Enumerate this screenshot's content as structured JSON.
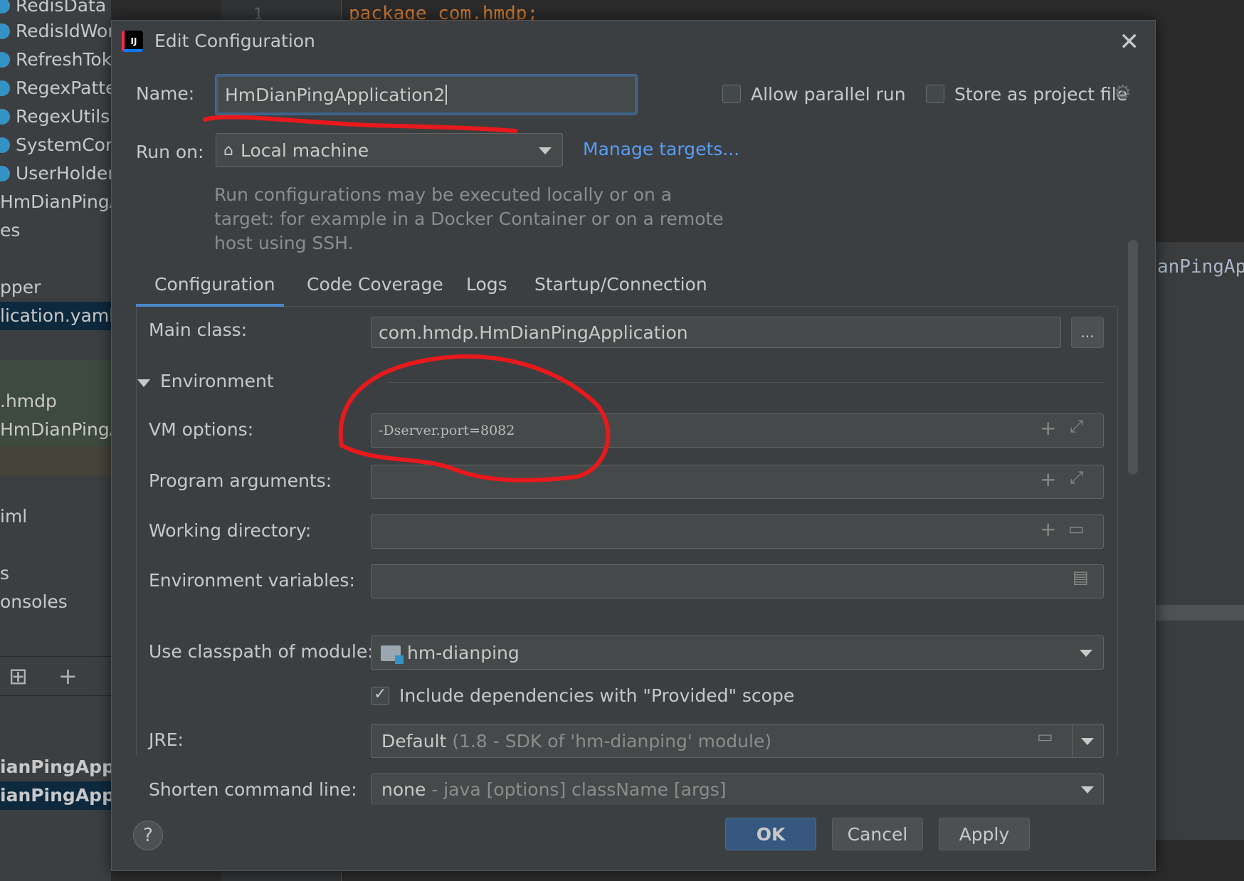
{
  "background": {
    "tree_items": [
      "RedisData",
      "RedisIdWor",
      "RefreshTok",
      "RegexPatte",
      "RegexUtils",
      "SystemCon",
      "UserHolder",
      "HmDianPingAp",
      "es",
      "",
      "pper",
      "lication.yaml",
      "",
      ".hmdp",
      "HmDianPingAp",
      "",
      "iml",
      "",
      "s",
      "onsoles"
    ],
    "bottom_items": [
      "ianPingAppli",
      "ianPingAppli"
    ],
    "code_line_number": "1",
    "code_text": "package com.hmdp;",
    "right_text": "anPingAp"
  },
  "dialog": {
    "title": "Edit Configuration",
    "close": "✕",
    "name_label": "Name:",
    "name_value": "HmDianPingApplication2",
    "allow_parallel_label": "Allow parallel run",
    "store_project_label": "Store as project file",
    "run_on_label": "Run on:",
    "run_on_value": "Local machine",
    "manage_targets": "Manage targets...",
    "hint": "Run configurations may be executed locally or on a target: for example in a Docker Container or on a remote host using SSH.",
    "tabs": [
      "Configuration",
      "Code Coverage",
      "Logs",
      "Startup/Connection"
    ],
    "main_class_label": "Main class:",
    "main_class_value": "com.hmdp.HmDianPingApplication",
    "browse": "...",
    "environment_label": "Environment",
    "vm_options_label": "VM options:",
    "vm_options_value": "-Dserver.port=8082",
    "program_args_label": "Program arguments:",
    "program_args_value": "",
    "working_dir_label": "Working directory:",
    "working_dir_value": "",
    "env_vars_label": "Environment variables:",
    "env_vars_value": "",
    "classpath_label": "Use classpath of module:",
    "classpath_value": "hm-dianping",
    "include_deps_label": "Include dependencies with \"Provided\" scope",
    "jre_label": "JRE:",
    "jre_value": "Default",
    "jre_detail": "(1.8 - SDK of 'hm-dianping' module)",
    "shorten_label": "Shorten command line:",
    "shorten_value": "none",
    "shorten_detail": "- java [options] className [args]",
    "help": "?",
    "ok": "OK",
    "cancel": "Cancel",
    "apply": "Apply"
  },
  "colors": {
    "annotation": "#e8191c",
    "accent": "#4a88c7",
    "link": "#589df6"
  }
}
